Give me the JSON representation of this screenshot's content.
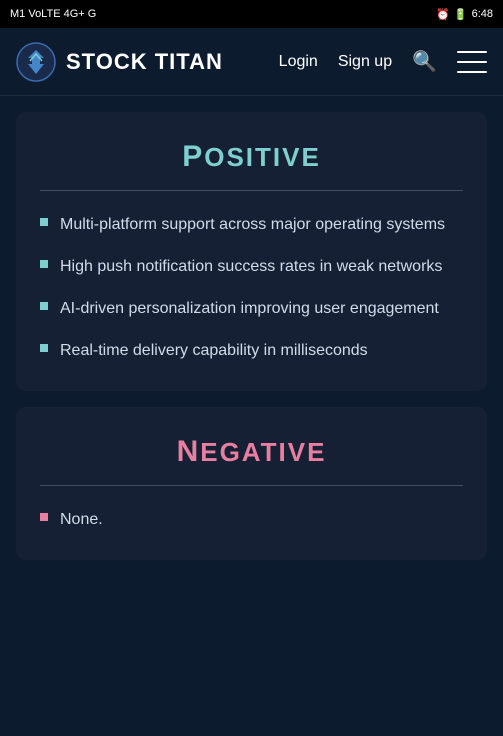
{
  "statusBar": {
    "left": "M1 VoLTE 4G+ G",
    "alarm": "⏰",
    "battery": "62",
    "time": "6:48"
  },
  "navbar": {
    "brandTitle": "STOCK TITAN",
    "loginLabel": "Login",
    "signupLabel": "Sign up"
  },
  "positiveCard": {
    "title": "Positive",
    "firstLetter": "P",
    "restTitle": "OSITIVE",
    "items": [
      "Multi-platform support across major operating systems",
      "High push notification success rates in weak networks",
      "AI-driven personalization improving user engagement",
      "Real-time delivery capability in milliseconds"
    ]
  },
  "negativeCard": {
    "title": "Negative",
    "firstLetter": "N",
    "restTitle": "EGATIVE",
    "items": [
      "None."
    ]
  }
}
